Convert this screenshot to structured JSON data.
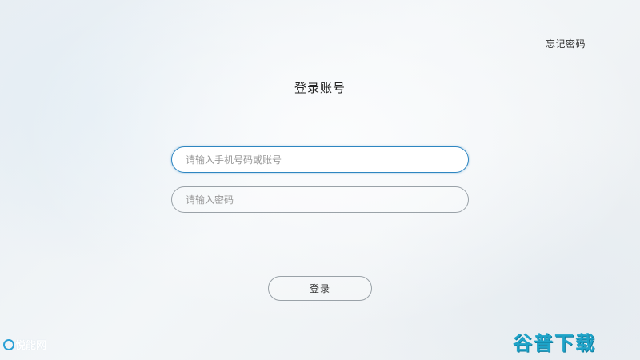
{
  "header": {
    "forgot_password": "忘记密码"
  },
  "form": {
    "title": "登录账号",
    "account_placeholder": "请输入手机号码或账号",
    "account_value": "",
    "password_placeholder": "请输入密码",
    "password_value": "",
    "login_label": "登录"
  },
  "footer": {
    "brand_left": "悦能网",
    "watermark": "谷普下载"
  },
  "colors": {
    "accent": "#2e86c1",
    "watermark": "#1ea3c8"
  }
}
